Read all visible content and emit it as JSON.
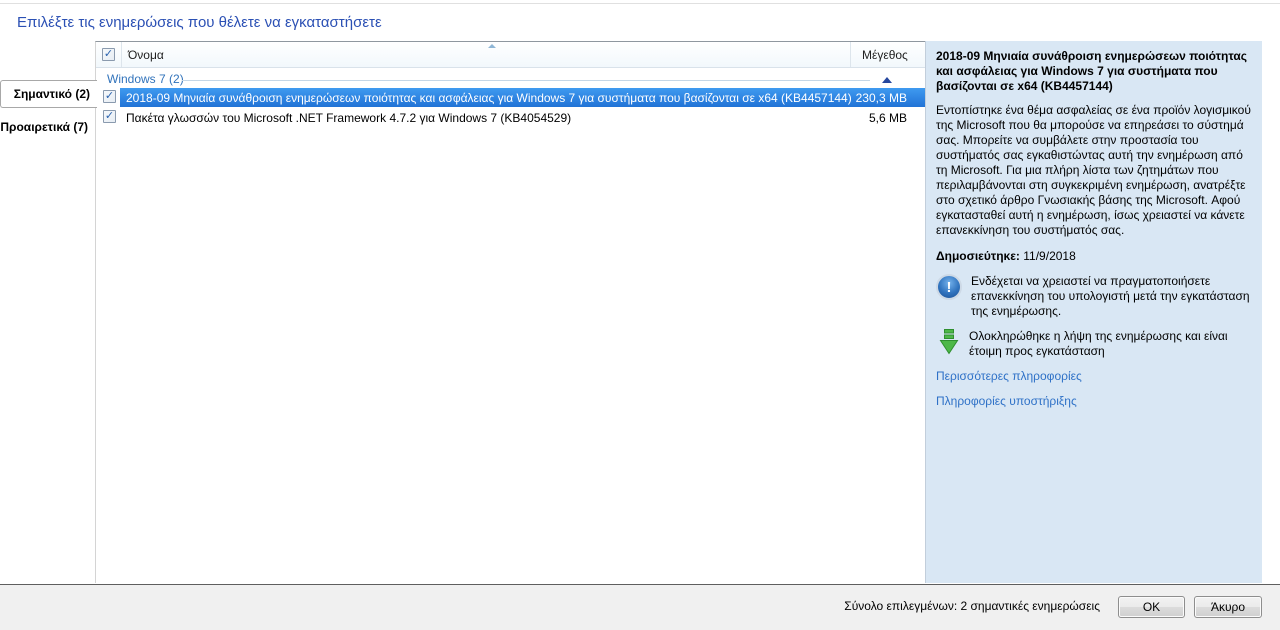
{
  "header": {
    "title": "Επιλέξτε τις ενημερώσεις που θέλετε να εγκαταστήσετε"
  },
  "sidebar": {
    "tabs": [
      {
        "label": "Σημαντικό (2)",
        "selected": true
      },
      {
        "label": "Προαιρετικά (7)",
        "selected": false
      }
    ]
  },
  "list": {
    "columns": {
      "name": "Όνομα",
      "size": "Μέγεθος"
    },
    "group": {
      "label": "Windows 7 (2)"
    },
    "rows": [
      {
        "name": "2018-09 Μηνιαία συνάθροιση ενημερώσεων ποιότητας και ασφάλειας για Windows 7 για συστήματα που βασίζονται σε x64 (KB4457144)",
        "size": "230,3 MB",
        "checked": true,
        "selected": true
      },
      {
        "name": "Πακέτα γλωσσών του Microsoft .NET Framework 4.7.2 για Windows 7 (KB4054529)",
        "size": "5,6 MB",
        "checked": true,
        "selected": false
      }
    ]
  },
  "details": {
    "title": "2018-09 Μηνιαία συνάθροιση ενημερώσεων ποιότητας και ασφάλειας για Windows 7 για συστήματα που βασίζονται σε x64 (KB4457144)",
    "description": "Εντοπίστηκε ένα θέμα ασφαλείας σε ένα προϊόν λογισμικού της Microsoft που θα μπορούσε να επηρεάσει το σύστημά σας. Μπορείτε να συμβάλετε στην προστασία του συστήματός σας εγκαθιστώντας αυτή την ενημέρωση από τη Microsoft. Για μια πλήρη λίστα των ζητημάτων που περιλαμβάνονται στη συγκεκριμένη ενημέρωση, ανατρέξτε στο σχετικό άρθρο Γνωσιακής βάσης της Microsoft. Αφού εγκατασταθεί αυτή η ενημέρωση, ίσως χρειαστεί να κάνετε επανεκκίνηση του συστήματός σας.",
    "published_label": "Δημοσιεύτηκε:",
    "published_date": "11/9/2018",
    "restart_note": "Ενδέχεται να χρειαστεί να πραγματοποιήσετε επανεκκίνηση του υπολογιστή μετά την εγκατάσταση της ενημέρωσης.",
    "download_note": "Ολοκληρώθηκε η λήψη της ενημέρωσης και είναι έτοιμη προς εγκατάσταση",
    "links": [
      {
        "label": "Περισσότερες πληροφορίες"
      },
      {
        "label": "Πληροφορίες υποστήριξης"
      }
    ]
  },
  "footer": {
    "summary": "Σύνολο επιλεγμένων: 2 σημαντικές ενημερώσεις",
    "ok_label": "OK",
    "cancel_label": "Άκυρο"
  },
  "icons": {
    "check": "✓",
    "exclamation": "!"
  },
  "colors": {
    "title_blue": "#2b50b4",
    "selection_top": "#3f9af0",
    "selection_bottom": "#2173d6",
    "group_header_blue": "#3173bb",
    "link_blue": "#2e71c7",
    "details_bg": "#d9e7f4",
    "footer_bg": "#f0f0f0",
    "download_green": "#4db848"
  }
}
